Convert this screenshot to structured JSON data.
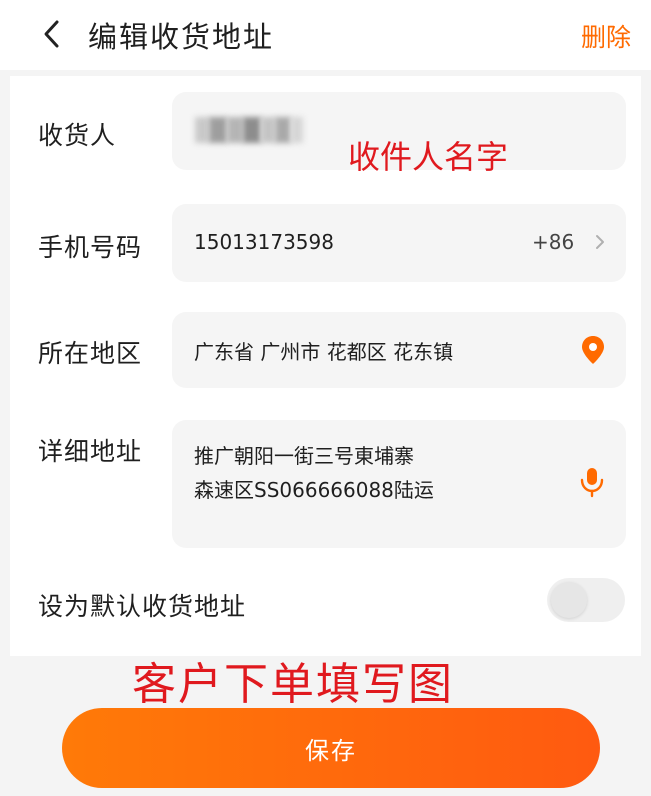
{
  "header": {
    "title": "编辑收货地址",
    "delete_label": "删除"
  },
  "form": {
    "recipient": {
      "label": "收货人"
    },
    "phone": {
      "label": "手机号码",
      "value": "15013173598",
      "prefix": "+86"
    },
    "region": {
      "label": "所在地区",
      "value": "广东省 广州市 花都区 花东镇"
    },
    "detail": {
      "label": "详细地址",
      "line1": "推广朝阳一街三号東埔寨",
      "line2": "森速区SS066666088陆运"
    },
    "default": {
      "label": "设为默认收货地址",
      "enabled": false
    }
  },
  "annotations": {
    "name_hint": "收件人名字",
    "figure_caption": "客户下单填写图"
  },
  "save_label": "保存",
  "colors": {
    "accent": "#ff6a00",
    "annotation_red": "#e0191e",
    "field_bg": "#f5f5f5"
  },
  "icons": {
    "back": "chevron-left-icon",
    "region": "location-pin-icon",
    "detail": "microphone-icon",
    "phone": "chevron-right-icon"
  }
}
